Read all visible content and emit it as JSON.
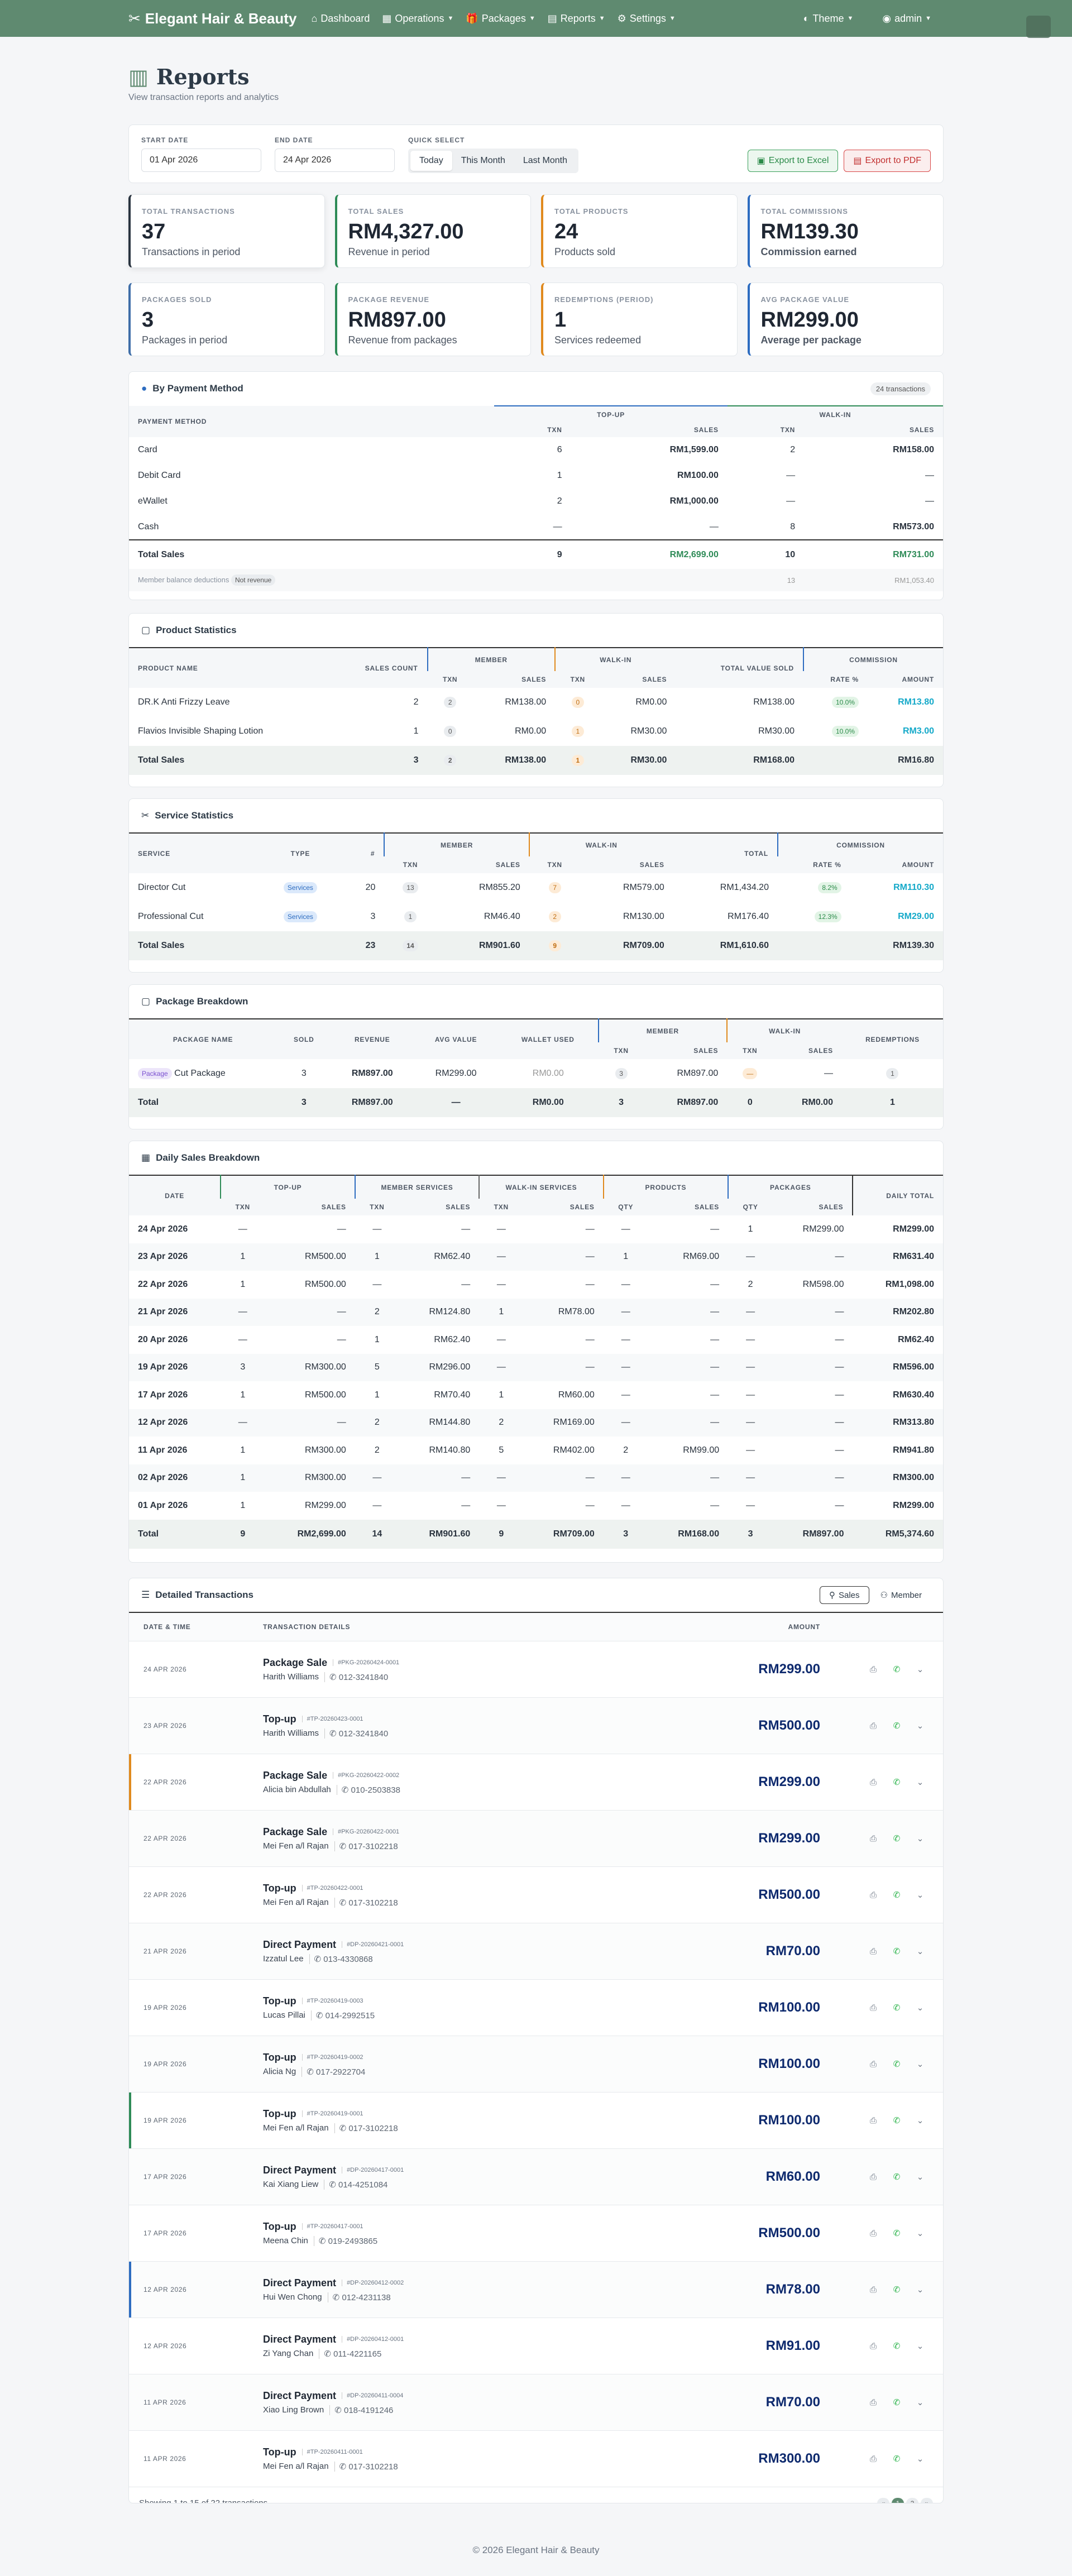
{
  "nav": {
    "brand": "Elegant Hair & Beauty",
    "items": [
      "Dashboard",
      "Operations",
      "Packages",
      "Reports",
      "Settings"
    ],
    "theme": "Theme",
    "user": "admin"
  },
  "header": {
    "title": "Reports",
    "subtitle": "View transaction reports and analytics"
  },
  "filters": {
    "start_label": "START DATE",
    "start_value": "01 Apr 2026",
    "end_label": "END DATE",
    "end_value": "24 Apr 2026",
    "quick_label": "QUICK SELECT",
    "quick": [
      "Today",
      "This Month",
      "Last Month"
    ],
    "export_excel": "Export to Excel",
    "export_pdf": "Export to PDF"
  },
  "stats": [
    {
      "label": "TOTAL TRANSACTIONS",
      "value": "37",
      "desc": "Transactions in period"
    },
    {
      "label": "TOTAL SALES",
      "value": "RM4,327.00",
      "desc": "Revenue in period"
    },
    {
      "label": "TOTAL PRODUCTS",
      "value": "24",
      "desc": "Products sold"
    },
    {
      "label": "TOTAL COMMISSIONS",
      "value": "RM139.30",
      "desc": "Commission earned"
    },
    {
      "label": "PACKAGES SOLD",
      "value": "3",
      "desc": "Packages in period"
    },
    {
      "label": "PACKAGE REVENUE",
      "value": "RM897.00",
      "desc": "Revenue from packages"
    },
    {
      "label": "REDEMPTIONS (PERIOD)",
      "value": "1",
      "desc": "Services redeemed"
    },
    {
      "label": "AVG PACKAGE VALUE",
      "value": "RM299.00",
      "desc": "Average per package"
    }
  ],
  "payment": {
    "title": "By Payment Method",
    "badge": "24 transactions",
    "h_method": "PAYMENT METHOD",
    "h_topup": "TOP-UP",
    "h_walkin": "WALK-IN",
    "h_txn": "TXN",
    "h_sales": "SALES",
    "rows": [
      [
        "Card",
        "6",
        "RM1,599.00",
        "2",
        "RM158.00"
      ],
      [
        "Debit Card",
        "1",
        "RM100.00",
        "—",
        "—"
      ],
      [
        "eWallet",
        "2",
        "RM1,000.00",
        "—",
        "—"
      ],
      [
        "Cash",
        "—",
        "—",
        "8",
        "RM573.00"
      ]
    ],
    "total": [
      "Total Sales",
      "9",
      "RM2,699.00",
      "10",
      "RM731.00"
    ],
    "member_deduct": "Member balance deductions",
    "not_revenue": "Not revenue",
    "md_txn": "13",
    "md_sales": "RM1,053.40"
  },
  "product": {
    "title": "Product Statistics",
    "h": [
      "PRODUCT NAME",
      "SALES COUNT",
      "MEMBER",
      "WALK-IN",
      "TOTAL VALUE SOLD",
      "COMMISSION",
      "TXN",
      "SALES",
      "RATE %",
      "AMOUNT"
    ],
    "rows": [
      [
        "DR.K Anti Frizzy Leave",
        "2",
        "2",
        "RM138.00",
        "0",
        "RM0.00",
        "RM138.00",
        "10.0%",
        "RM13.80"
      ],
      [
        "Flavios Invisible Shaping Lotion",
        "1",
        "0",
        "RM0.00",
        "1",
        "RM30.00",
        "RM30.00",
        "10.0%",
        "RM3.00"
      ]
    ],
    "total": [
      "Total Sales",
      "3",
      "2",
      "RM138.00",
      "1",
      "RM30.00",
      "RM168.00",
      "RM16.80"
    ]
  },
  "service": {
    "title": "Service Statistics",
    "h": [
      "SERVICE",
      "TYPE",
      "#",
      "MEMBER",
      "WALK-IN",
      "TOTAL",
      "COMMISSION",
      "TXN",
      "SALES",
      "RATE %",
      "AMOUNT"
    ],
    "rows": [
      [
        "Director Cut",
        "Services",
        "20",
        "13",
        "RM855.20",
        "7",
        "RM579.00",
        "RM1,434.20",
        "8.2%",
        "RM110.30"
      ],
      [
        "Professional Cut",
        "Services",
        "3",
        "1",
        "RM46.40",
        "2",
        "RM130.00",
        "RM176.40",
        "12.3%",
        "RM29.00"
      ]
    ],
    "total": [
      "Total Sales",
      "23",
      "14",
      "RM901.60",
      "9",
      "RM709.00",
      "RM1,610.60",
      "RM139.30"
    ]
  },
  "package": {
    "title": "Package Breakdown",
    "h": [
      "PACKAGE NAME",
      "SOLD",
      "REVENUE",
      "AVG VALUE",
      "WALLET USED",
      "MEMBER",
      "WALK-IN",
      "REDEMPTIONS",
      "TXN",
      "SALES"
    ],
    "row": [
      "Package",
      "Cut Package",
      "3",
      "RM897.00",
      "RM299.00",
      "RM0.00",
      "3",
      "RM897.00",
      "—",
      "—",
      "1"
    ],
    "total": [
      "Total",
      "3",
      "RM897.00",
      "—",
      "RM0.00",
      "3",
      "RM897.00",
      "0",
      "RM0.00",
      "1"
    ]
  },
  "daily": {
    "title": "Daily Sales Breakdown",
    "h": [
      "DATE",
      "TOP-UP",
      "MEMBER SERVICES",
      "WALK-IN SERVICES",
      "PRODUCTS",
      "PACKAGES",
      "DAILY TOTAL",
      "TXN",
      "SALES",
      "QTY"
    ],
    "rows": [
      [
        "24 Apr 2026",
        "—",
        "—",
        "—",
        "—",
        "—",
        "—",
        "—",
        "—",
        "1",
        "RM299.00",
        "RM299.00"
      ],
      [
        "23 Apr 2026",
        "1",
        "RM500.00",
        "1",
        "RM62.40",
        "—",
        "—",
        "1",
        "RM69.00",
        "—",
        "—",
        "RM631.40"
      ],
      [
        "22 Apr 2026",
        "1",
        "RM500.00",
        "—",
        "—",
        "—",
        "—",
        "—",
        "—",
        "2",
        "RM598.00",
        "RM1,098.00"
      ],
      [
        "21 Apr 2026",
        "—",
        "—",
        "2",
        "RM124.80",
        "1",
        "RM78.00",
        "—",
        "—",
        "—",
        "—",
        "RM202.80"
      ],
      [
        "20 Apr 2026",
        "—",
        "—",
        "1",
        "RM62.40",
        "—",
        "—",
        "—",
        "—",
        "—",
        "—",
        "RM62.40"
      ],
      [
        "19 Apr 2026",
        "3",
        "RM300.00",
        "5",
        "RM296.00",
        "—",
        "—",
        "—",
        "—",
        "—",
        "—",
        "RM596.00"
      ],
      [
        "17 Apr 2026",
        "1",
        "RM500.00",
        "1",
        "RM70.40",
        "1",
        "RM60.00",
        "—",
        "—",
        "—",
        "—",
        "RM630.40"
      ],
      [
        "12 Apr 2026",
        "—",
        "—",
        "2",
        "RM144.80",
        "2",
        "RM169.00",
        "—",
        "—",
        "—",
        "—",
        "RM313.80"
      ],
      [
        "11 Apr 2026",
        "1",
        "RM300.00",
        "2",
        "RM140.80",
        "5",
        "RM402.00",
        "2",
        "RM99.00",
        "—",
        "—",
        "RM941.80"
      ],
      [
        "02 Apr 2026",
        "1",
        "RM300.00",
        "—",
        "—",
        "—",
        "—",
        "—",
        "—",
        "—",
        "—",
        "RM300.00"
      ],
      [
        "01 Apr 2026",
        "1",
        "RM299.00",
        "—",
        "—",
        "—",
        "—",
        "—",
        "—",
        "—",
        "—",
        "RM299.00"
      ]
    ],
    "total": [
      "Total",
      "9",
      "RM2,699.00",
      "14",
      "RM901.60",
      "9",
      "RM709.00",
      "3",
      "RM168.00",
      "3",
      "RM897.00",
      "RM5,374.60"
    ]
  },
  "detail": {
    "title": "Detailed Transactions",
    "tab_sales": "Sales",
    "tab_member": "Member",
    "h_date": "DATE & TIME",
    "h_details": "TRANSACTION DETAILS",
    "h_amount": "AMOUNT",
    "rows": [
      [
        "24 APR 2026",
        "Package Sale",
        "#PKG-20260424-0001",
        "Harith Williams",
        "012-3241840",
        "RM299.00"
      ],
      [
        "23 APR 2026",
        "Top-up",
        "#TP-20260423-0001",
        "Harith Williams",
        "012-3241840",
        "RM500.00"
      ],
      [
        "22 APR 2026",
        "Package Sale",
        "#PKG-20260422-0002",
        "Alicia bin Abdullah",
        "010-2503838",
        "RM299.00"
      ],
      [
        "22 APR 2026",
        "Package Sale",
        "#PKG-20260422-0001",
        "Mei Fen a/l Rajan",
        "017-3102218",
        "RM299.00"
      ],
      [
        "22 APR 2026",
        "Top-up",
        "#TP-20260422-0001",
        "Mei Fen a/l Rajan",
        "017-3102218",
        "RM500.00"
      ],
      [
        "21 APR 2026",
        "Direct Payment",
        "#DP-20260421-0001",
        "Izzatul Lee",
        "013-4330868",
        "RM70.00"
      ],
      [
        "19 APR 2026",
        "Top-up",
        "#TP-20260419-0003",
        "Lucas Pillai",
        "014-2992515",
        "RM100.00"
      ],
      [
        "19 APR 2026",
        "Top-up",
        "#TP-20260419-0002",
        "Alicia Ng",
        "017-2922704",
        "RM100.00"
      ],
      [
        "19 APR 2026",
        "Top-up",
        "#TP-20260419-0001",
        "Mei Fen a/l Rajan",
        "017-3102218",
        "RM100.00"
      ],
      [
        "17 APR 2026",
        "Direct Payment",
        "#DP-20260417-0001",
        "Kai Xiang Liew",
        "014-4251084",
        "RM60.00"
      ],
      [
        "17 APR 2026",
        "Top-up",
        "#TP-20260417-0001",
        "Meena Chin",
        "019-2493865",
        "RM500.00"
      ],
      [
        "12 APR 2026",
        "Direct Payment",
        "#DP-20260412-0002",
        "Hui Wen Chong",
        "012-4231138",
        "RM78.00"
      ],
      [
        "12 APR 2026",
        "Direct Payment",
        "#DP-20260412-0001",
        "Zi Yang Chan",
        "011-4221165",
        "RM91.00"
      ],
      [
        "11 APR 2026",
        "Direct Payment",
        "#DP-20260411-0004",
        "Xiao Ling Brown",
        "018-4191246",
        "RM70.00"
      ],
      [
        "11 APR 2026",
        "Top-up",
        "#TP-20260411-0001",
        "Mei Fen a/l Rajan",
        "017-3102218",
        "RM300.00"
      ]
    ],
    "showing": "Showing 1 to 15 of 22 transactions",
    "pages": [
      "1",
      "2"
    ]
  },
  "footer": "© 2026 Elegant Hair & Beauty"
}
